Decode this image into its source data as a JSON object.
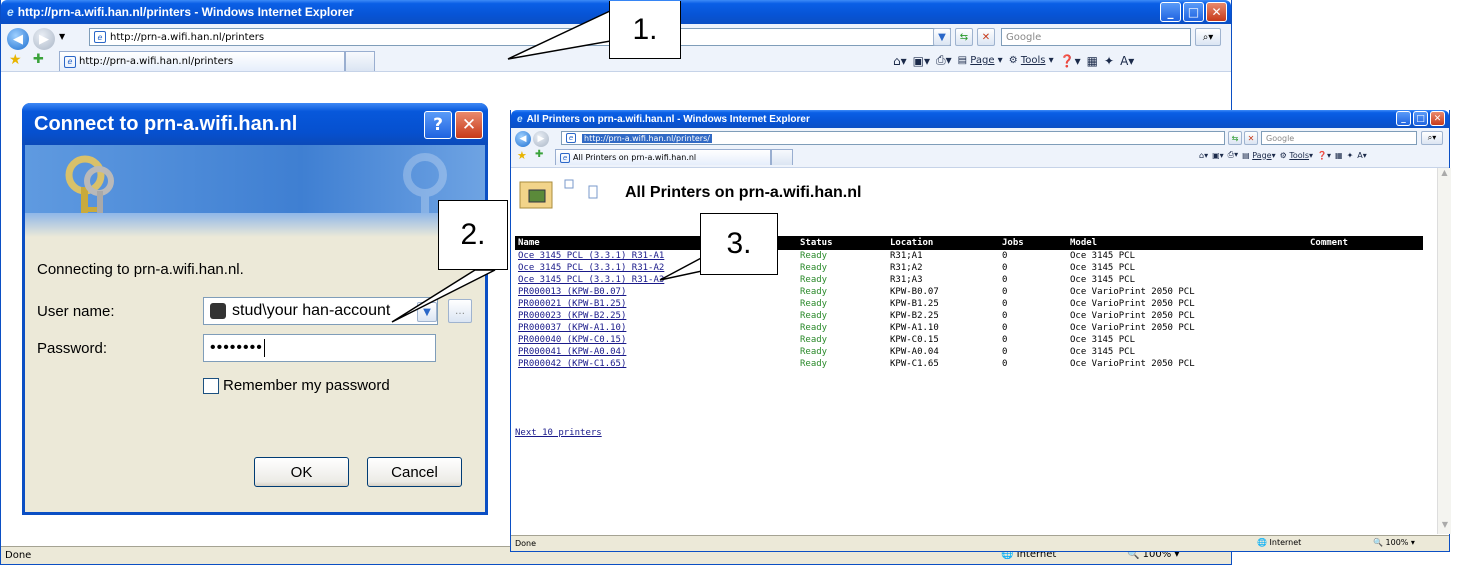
{
  "outer": {
    "title": "http://prn-a.wifi.han.nl/printers - Windows Internet Explorer",
    "address": "http://prn-a.wifi.han.nl/printers",
    "search_placeholder": "Google",
    "tab_label": "http://prn-a.wifi.han.nl/printers",
    "status": "Done",
    "zone": "Internet",
    "zoom": "100%",
    "cmd": {
      "page": "Page",
      "tools": "Tools"
    }
  },
  "dialog": {
    "title": "Connect to prn-a.wifi.han.nl",
    "connecting": "Connecting to prn-a.wifi.han.nl.",
    "username_label": "User name:",
    "username_value": "stud\\your han-account",
    "password_label": "Password:",
    "password_value": "••••••••",
    "remember_label": "Remember my password",
    "ok_label": "OK",
    "cancel_label": "Cancel"
  },
  "inner": {
    "title": "All Printers on prn-a.wifi.han.nl - Windows Internet Explorer",
    "address": "http://prn-a.wifi.han.nl/printers/",
    "search_placeholder": "Google",
    "tab_label": "All Printers on prn-a.wifi.han.nl",
    "heading": "All Printers on prn-a.wifi.han.nl",
    "status": "Done",
    "zone": "Internet",
    "zoom": "100%",
    "cmd": {
      "page": "Page",
      "tools": "Tools"
    },
    "columns": [
      "Name",
      "Status",
      "Location",
      "Jobs",
      "Model",
      "Comment"
    ],
    "rows": [
      [
        "Oce 3145 PCL (3.3.1) R31-A1",
        "Ready",
        "R31;A1",
        "0",
        "Oce 3145 PCL",
        ""
      ],
      [
        "Oce 3145 PCL (3.3.1) R31-A2",
        "Ready",
        "R31;A2",
        "0",
        "Oce 3145 PCL",
        ""
      ],
      [
        "Oce 3145 PCL (3.3.1) R31-A3",
        "Ready",
        "R31;A3",
        "0",
        "Oce 3145 PCL",
        ""
      ],
      [
        "PR000013 (KPW-B0.07)",
        "Ready",
        "KPW-B0.07",
        "0",
        "Oce VarioPrint 2050 PCL",
        ""
      ],
      [
        "PR000021 (KPW-B1.25)",
        "Ready",
        "KPW-B1.25",
        "0",
        "Oce VarioPrint 2050 PCL",
        ""
      ],
      [
        "PR000023 (KPW-B2.25)",
        "Ready",
        "KPW-B2.25",
        "0",
        "Oce VarioPrint 2050 PCL",
        ""
      ],
      [
        "PR000037 (KPW-A1.10)",
        "Ready",
        "KPW-A1.10",
        "0",
        "Oce VarioPrint 2050 PCL",
        ""
      ],
      [
        "PR000040 (KPW-C0.15)",
        "Ready",
        "KPW-C0.15",
        "0",
        "Oce 3145 PCL",
        ""
      ],
      [
        "PR000041 (KPW-A0.04)",
        "Ready",
        "KPW-A0.04",
        "0",
        "Oce 3145 PCL",
        ""
      ],
      [
        "PR000042 (KPW-C1.65)",
        "Ready",
        "KPW-C1.65",
        "0",
        "Oce VarioPrint 2050 PCL",
        ""
      ]
    ],
    "next_link": "Next 10 printers"
  },
  "callouts": {
    "c1": "1.",
    "c2": "2.",
    "c3": "3."
  },
  "colors": {
    "xp_blue": "#0754d6",
    "ready_green": "#2b8a2b",
    "close_red": "#c73a1a"
  }
}
